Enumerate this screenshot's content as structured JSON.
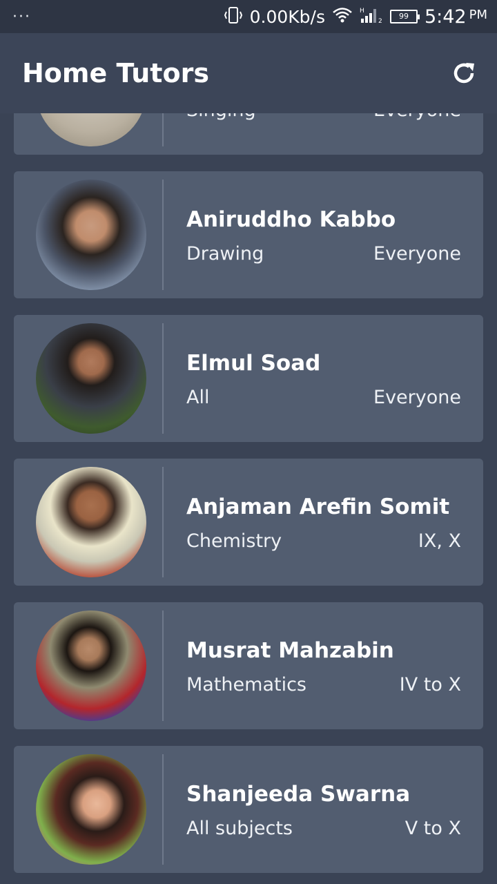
{
  "status_bar": {
    "left_dots": "···",
    "network_speed": "0.00Kb/s",
    "signal_label": "H",
    "battery": "99",
    "time": "5:42",
    "ampm": "PM"
  },
  "app_bar": {
    "title": "Home Tutors",
    "refresh_icon": "refresh-icon"
  },
  "tutors": [
    {
      "name": "",
      "subject": "Singing",
      "level": "Everyone",
      "avatar_colors": [
        "#b9b0a0",
        "#d8d2c6"
      ]
    },
    {
      "name": "Aniruddho Kabbo",
      "subject": "Drawing",
      "level": "Everyone",
      "avatar_colors": [
        "#7a8aa0",
        "#2b2420"
      ]
    },
    {
      "name": "Elmul Soad",
      "subject": "All",
      "level": "Everyone",
      "avatar_colors": [
        "#3f5b2e",
        "#3a3f48"
      ]
    },
    {
      "name": "Anjaman Arefin Somit",
      "subject": "Chemistry",
      "level": "IX, X",
      "avatar_colors": [
        "#e9e4c9",
        "#b8533f"
      ]
    },
    {
      "name": "Musrat Mahzabin",
      "subject": "Mathematics",
      "level": "IV to X",
      "avatar_colors": [
        "#8f8a70",
        "#b3262c"
      ]
    },
    {
      "name": "Shanjeeda Swarna",
      "subject": "All subjects",
      "level": "V to X",
      "avatar_colors": [
        "#7fb04c",
        "#2a1c18"
      ]
    }
  ]
}
